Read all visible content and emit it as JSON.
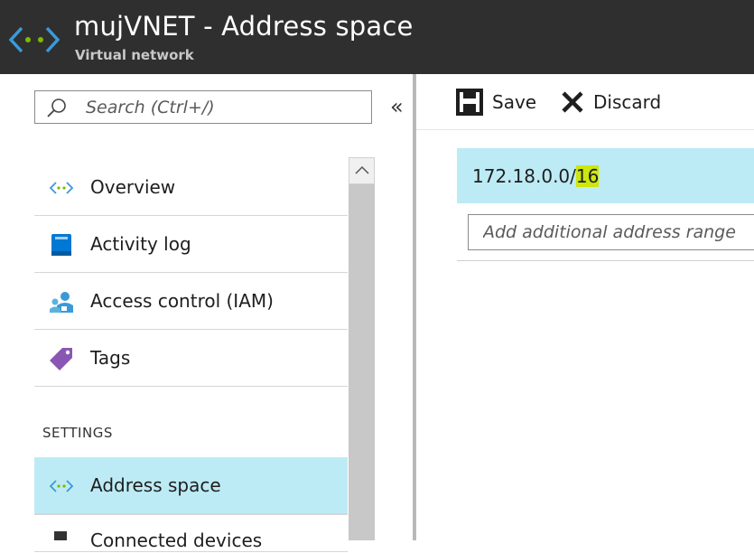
{
  "header": {
    "title": "mujVNET - Address space",
    "subtitle": "Virtual network",
    "icon": "vnet-icon"
  },
  "search": {
    "placeholder": "Search (Ctrl+/)",
    "icon": "search-icon"
  },
  "collapse_glyph": "«",
  "menu": {
    "items": [
      {
        "label": "Overview",
        "icon": "vnet-icon"
      },
      {
        "label": "Activity log",
        "icon": "activity-log-icon"
      },
      {
        "label": "Access control (IAM)",
        "icon": "iam-icon"
      },
      {
        "label": "Tags",
        "icon": "tag-icon"
      }
    ],
    "section": "SETTINGS",
    "settings_items": [
      {
        "label": "Address space",
        "icon": "vnet-icon",
        "selected": true
      },
      {
        "label": "Connected devices",
        "icon": "connected-devices-icon"
      }
    ]
  },
  "toolbar": {
    "save_label": "Save",
    "discard_label": "Discard"
  },
  "address_space": {
    "prefix": "172.18.0.0/",
    "highlighted": "16",
    "add_placeholder": "Add additional address range"
  },
  "colors": {
    "header_bg": "#2f2f2f",
    "selected_bg": "#bdebf5",
    "highlight": "#cde60d",
    "vnet_blue": "#3a9ad9",
    "vnet_green": "#7fba00",
    "tag_purple": "#8a56b3"
  }
}
